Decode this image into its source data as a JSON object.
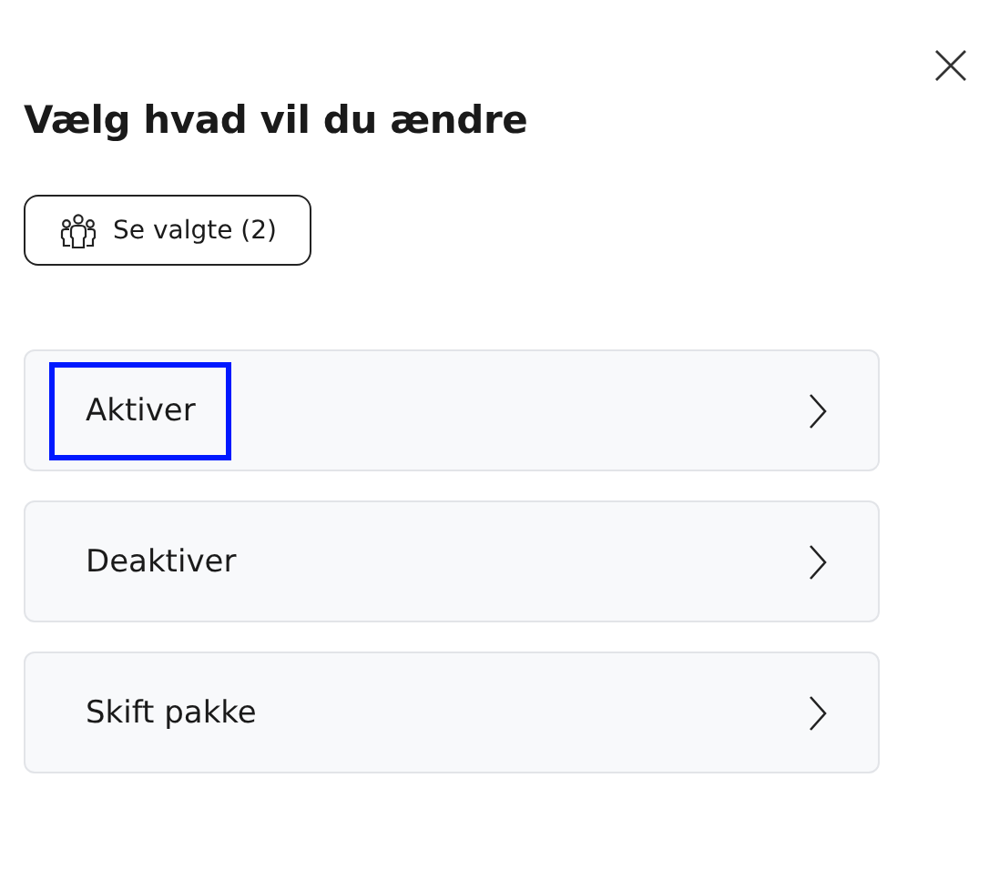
{
  "dialog": {
    "title": "Vælg hvad vil du ændre",
    "selected_button": {
      "label": "Se valgte (2)"
    },
    "options": [
      {
        "label": "Aktiver",
        "focused": true
      },
      {
        "label": "Deaktiver",
        "focused": false
      },
      {
        "label": "Skift pakke",
        "focused": false
      }
    ]
  }
}
